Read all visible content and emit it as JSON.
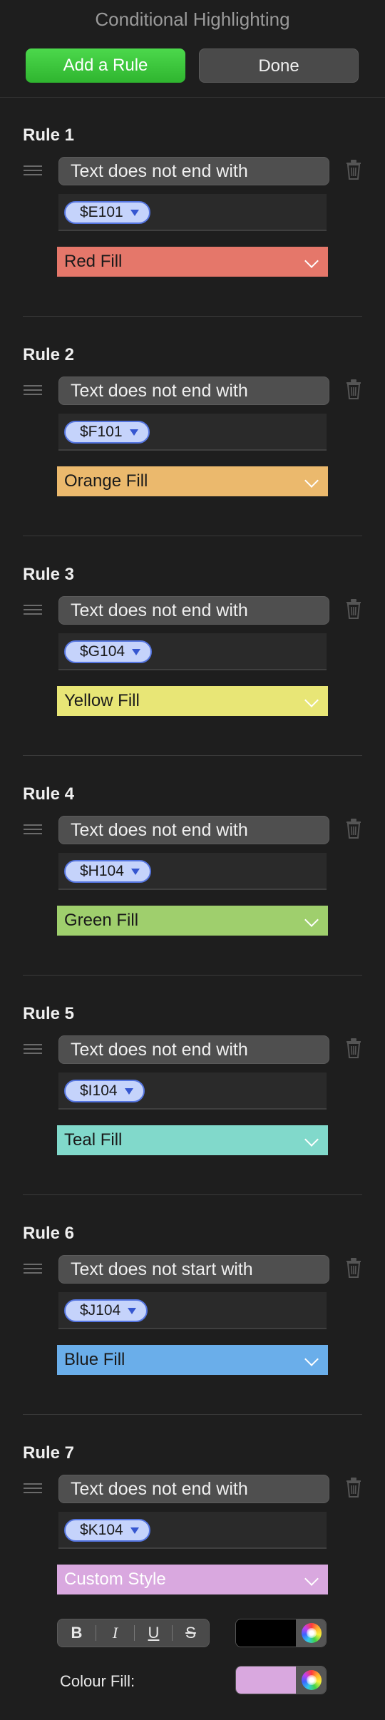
{
  "window": {
    "title": "Conditional Highlighting"
  },
  "toolbar": {
    "add_label": "Add a Rule",
    "done_label": "Done"
  },
  "rules": [
    {
      "title": "Rule 1",
      "condition": "Text does not end with",
      "ref": "$E101",
      "fill": "Red Fill",
      "fill_color": "#e5776a"
    },
    {
      "title": "Rule 2",
      "condition": "Text does not end with",
      "ref": "$F101",
      "fill": "Orange Fill",
      "fill_color": "#ebb96d"
    },
    {
      "title": "Rule 3",
      "condition": "Text does not end with",
      "ref": "$G104",
      "fill": "Yellow Fill",
      "fill_color": "#e8e676"
    },
    {
      "title": "Rule 4",
      "condition": "Text does not end with",
      "ref": "$H104",
      "fill": "Green Fill",
      "fill_color": "#9fcf6d"
    },
    {
      "title": "Rule 5",
      "condition": "Text does not end with",
      "ref": "$I104",
      "fill": "Teal Fill",
      "fill_color": "#81d9cb"
    },
    {
      "title": "Rule 6",
      "condition": "Text does not start with",
      "ref": "$J104",
      "fill": "Blue Fill",
      "fill_color": "#6aaeea"
    },
    {
      "title": "Rule 7",
      "condition": "Text does not end with",
      "ref": "$K104",
      "fill": "Custom Style",
      "fill_color": "#d9a8df"
    }
  ],
  "custom_style": {
    "bold": "B",
    "italic": "I",
    "underline": "U",
    "strikethrough": "S",
    "text_color": "#000000",
    "colour_fill_label": "Colour Fill:",
    "colour_fill": "#d9a8df"
  },
  "icons": {
    "drag": "drag-handle-icon",
    "delete": "trash-icon",
    "dropdown": "chevron-down-icon",
    "color_picker": "color-wheel-icon"
  }
}
